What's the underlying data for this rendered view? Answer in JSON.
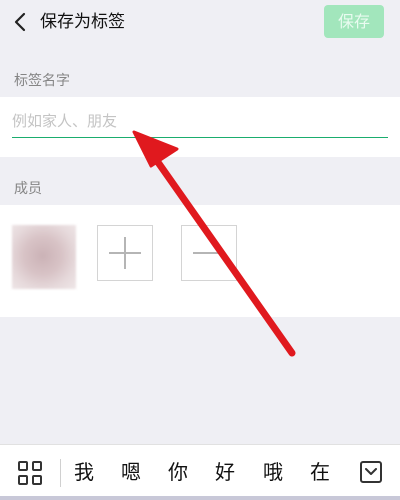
{
  "header": {
    "title": "保存为标签",
    "save_label": "保存"
  },
  "tag_name": {
    "section_title": "标签名字",
    "placeholder": "例如家人、朋友",
    "value": ""
  },
  "members": {
    "section_title": "成员"
  },
  "keyboard": {
    "candidates": [
      "我",
      "嗯",
      "你",
      "好",
      "哦",
      "在"
    ]
  },
  "colors": {
    "accent": "#1aad6e",
    "save_button_disabled": "#a2e6bc",
    "annotation_arrow": "#e0191e",
    "background": "#efeff4"
  },
  "icons": {
    "back": "chevron-left-icon",
    "add": "plus-icon",
    "remove": "minus-icon",
    "keyboard_grid": "grid-icon",
    "keyboard_collapse": "chevron-down-icon"
  }
}
